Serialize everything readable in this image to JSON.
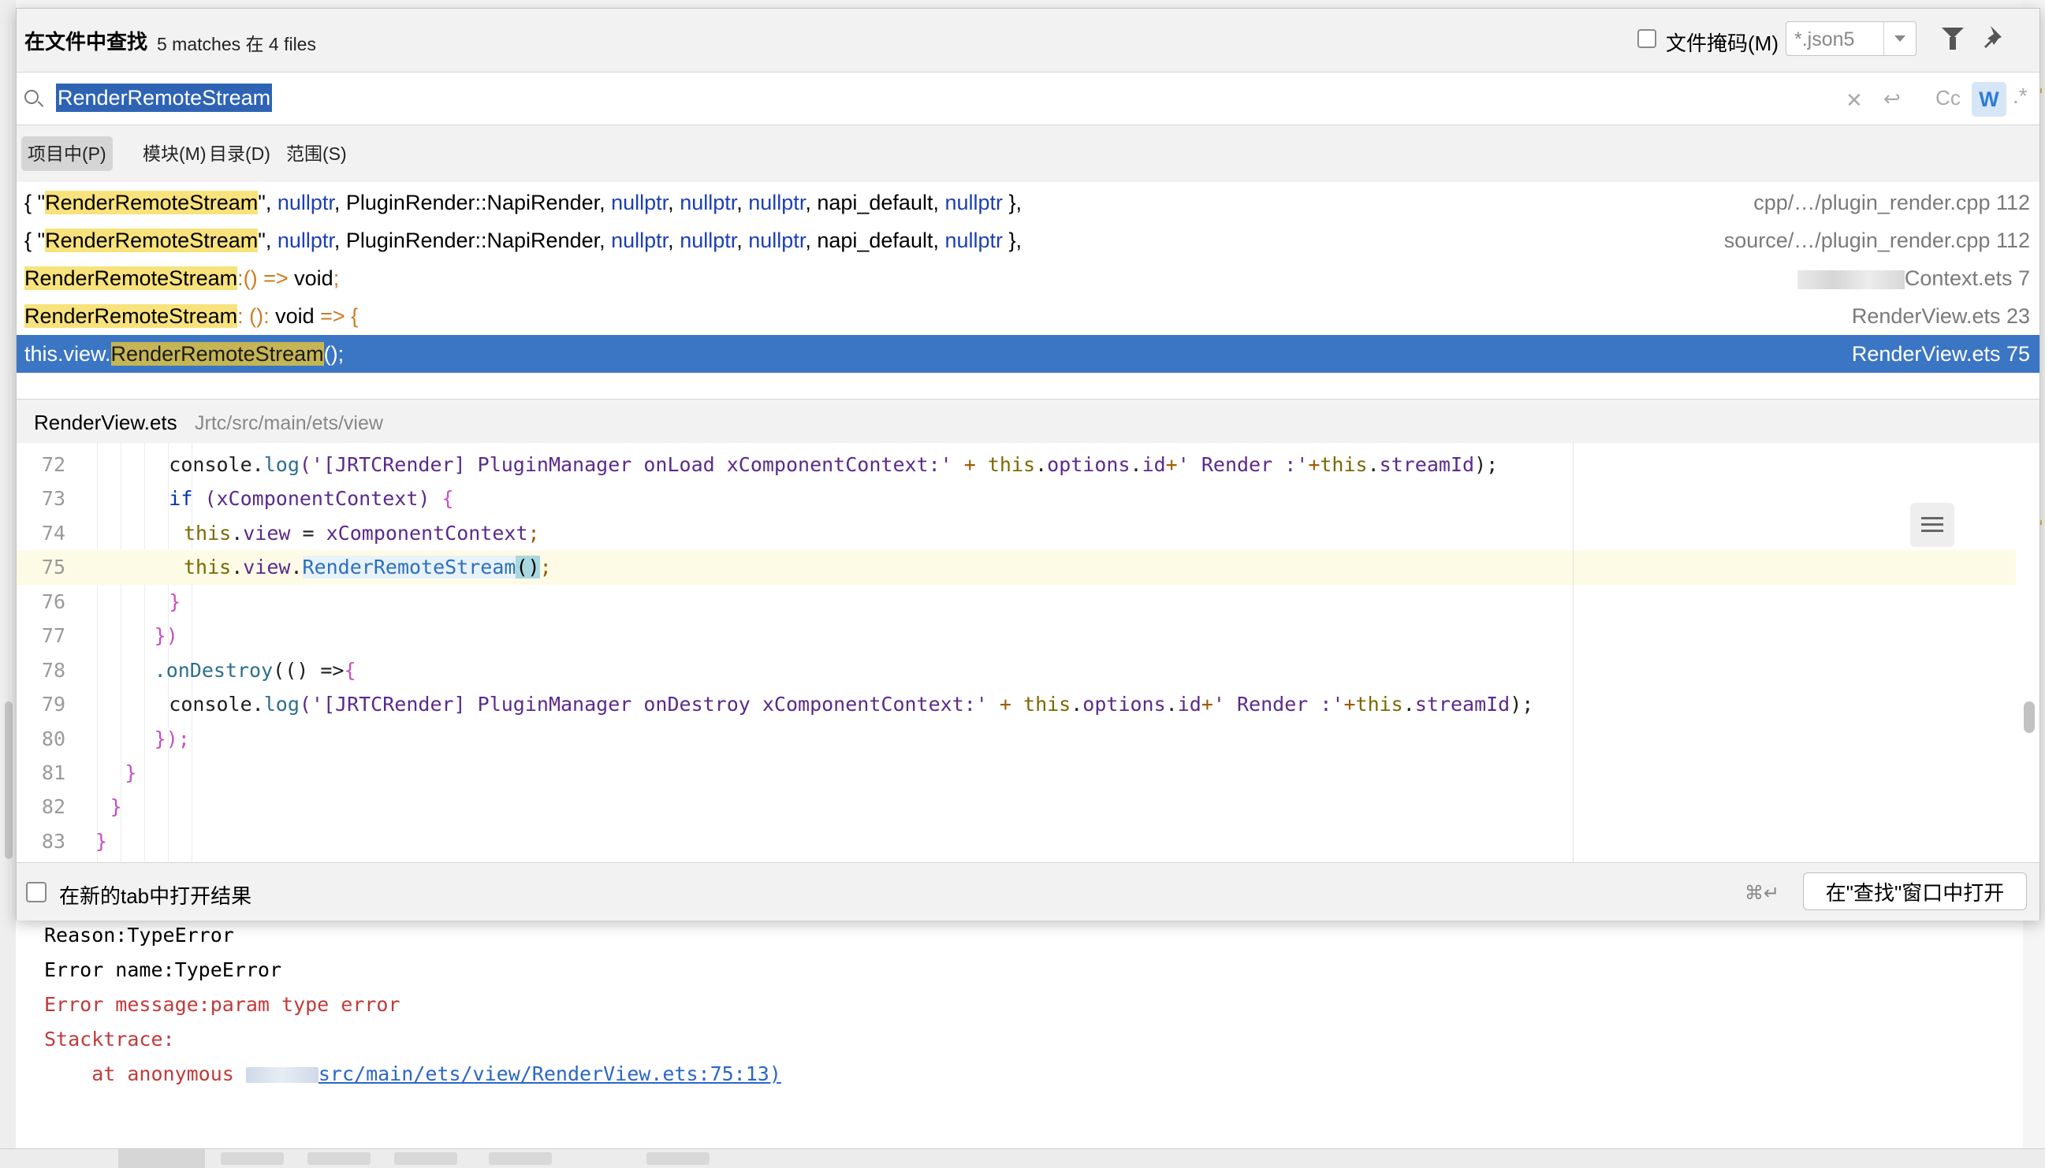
{
  "header": {
    "title": "在文件中查找",
    "match_count": "5 matches 在 4 files",
    "file_mask_label": "文件掩码(M)",
    "file_mask_value": "*.json5"
  },
  "search": {
    "query": "RenderRemoteStream",
    "match_case_label": "Cc",
    "words_label": "W",
    "regex_label": ".*"
  },
  "scopes": [
    {
      "label": "项目中(P)",
      "selected": true
    },
    {
      "label": "模块(M)",
      "selected": false
    },
    {
      "label": "目录(D)",
      "selected": false
    },
    {
      "label": "范围(S)",
      "selected": false
    }
  ],
  "results": [
    {
      "pre": "{ \"",
      "match": "RenderRemoteStream",
      "tokens": [
        {
          "t": "\", ",
          "c": ""
        },
        {
          "t": "nullptr",
          "c": "kw"
        },
        {
          "t": ", PluginRender::NapiRender, ",
          "c": ""
        },
        {
          "t": "nullptr",
          "c": "kw"
        },
        {
          "t": ", ",
          "c": ""
        },
        {
          "t": "nullptr",
          "c": "kw"
        },
        {
          "t": ", ",
          "c": ""
        },
        {
          "t": "nullptr",
          "c": "kw"
        },
        {
          "t": ", napi_default, ",
          "c": ""
        },
        {
          "t": "nullptr",
          "c": "kw"
        },
        {
          "t": " },",
          "c": ""
        }
      ],
      "location": "cpp/…/plugin_render.cpp 112"
    },
    {
      "pre": "{ \"",
      "match": "RenderRemoteStream",
      "tokens": [
        {
          "t": "\", ",
          "c": ""
        },
        {
          "t": "nullptr",
          "c": "kw"
        },
        {
          "t": ", PluginRender::NapiRender, ",
          "c": ""
        },
        {
          "t": "nullptr",
          "c": "kw"
        },
        {
          "t": ", ",
          "c": ""
        },
        {
          "t": "nullptr",
          "c": "kw"
        },
        {
          "t": ", ",
          "c": ""
        },
        {
          "t": "nullptr",
          "c": "kw"
        },
        {
          "t": ", napi_default, ",
          "c": ""
        },
        {
          "t": "nullptr",
          "c": "kw"
        },
        {
          "t": " },",
          "c": ""
        }
      ],
      "location": "source/…/plugin_render.cpp 112"
    },
    {
      "pre": "",
      "match": "RenderRemoteStream",
      "tokens": [
        {
          "t": ":() => ",
          "c": "op"
        },
        {
          "t": "void",
          "c": ""
        },
        {
          "t": ";",
          "c": "op"
        }
      ],
      "location": "Context.ets 7",
      "location_blurred": true
    },
    {
      "pre": "",
      "match": "RenderRemoteStream",
      "tokens": [
        {
          "t": ": (): ",
          "c": "op"
        },
        {
          "t": "void",
          "c": ""
        },
        {
          "t": " => {",
          "c": "op"
        }
      ],
      "location": "RenderView.ets 23"
    },
    {
      "pre": "this.view.",
      "match": "RenderRemoteStream",
      "tokens": [
        {
          "t": "();",
          "c": ""
        }
      ],
      "location": "RenderView.ets 75",
      "selected": true
    }
  ],
  "preview": {
    "file": "RenderView.ets",
    "path": "Jrtc/src/main/ets/view",
    "lines": [
      {
        "n": "72",
        "indent": 5,
        "tokens": [
          {
            "t": "console",
            "c": "c-plain"
          },
          {
            "t": ".",
            "c": "c-plain"
          },
          {
            "t": "log",
            "c": "c-func"
          },
          {
            "t": "('[JRTCRender] PluginManager onLoad xComponentContext:' ",
            "c": "c-prop"
          },
          {
            "t": "+ ",
            "c": "c-semi"
          },
          {
            "t": "this",
            "c": "c-this"
          },
          {
            "t": ".",
            "c": "c-plain"
          },
          {
            "t": "options",
            "c": "c-prop"
          },
          {
            "t": ".",
            "c": "c-plain"
          },
          {
            "t": "id",
            "c": "c-prop"
          },
          {
            "t": "+",
            "c": "c-semi"
          },
          {
            "t": "' Render :'",
            "c": "c-prop"
          },
          {
            "t": "+",
            "c": "c-semi"
          },
          {
            "t": "this",
            "c": "c-this"
          },
          {
            "t": ".",
            "c": "c-plain"
          },
          {
            "t": "streamId",
            "c": "c-prop"
          },
          {
            "t": ");",
            "c": "c-plain"
          }
        ]
      },
      {
        "n": "73",
        "indent": 5,
        "tokens": [
          {
            "t": "if",
            "c": "c-key"
          },
          {
            "t": " (xComponentContext) ",
            "c": "c-prop"
          },
          {
            "t": "{",
            "c": "c-br"
          }
        ]
      },
      {
        "n": "74",
        "indent": 6,
        "tokens": [
          {
            "t": "this",
            "c": "c-this"
          },
          {
            "t": ".",
            "c": "c-plain"
          },
          {
            "t": "view",
            "c": "c-prop"
          },
          {
            "t": " = ",
            "c": "c-plain"
          },
          {
            "t": "xComponentContext",
            "c": "c-prop"
          },
          {
            "t": ";",
            "c": "c-semi"
          }
        ]
      },
      {
        "n": "75",
        "indent": 6,
        "current": true,
        "tokens": [
          {
            "t": "this",
            "c": "c-this"
          },
          {
            "t": ".",
            "c": "c-plain"
          },
          {
            "t": "view",
            "c": "c-prop"
          },
          {
            "t": ".",
            "c": "c-plain"
          },
          {
            "t": "RenderRemoteStream",
            "c": "c-call"
          },
          {
            "t": "()",
            "c": "c-paren"
          },
          {
            "t": ";",
            "c": "c-semi"
          }
        ]
      },
      {
        "n": "76",
        "indent": 5,
        "tokens": [
          {
            "t": "}",
            "c": "c-br"
          }
        ]
      },
      {
        "n": "77",
        "indent": 4,
        "tokens": [
          {
            "t": "})",
            "c": "c-br"
          }
        ]
      },
      {
        "n": "78",
        "indent": 4,
        "tokens": [
          {
            "t": ".onDestroy",
            "c": "c-func"
          },
          {
            "t": "(() =>",
            "c": "c-plain"
          },
          {
            "t": "{",
            "c": "c-br"
          }
        ]
      },
      {
        "n": "79",
        "indent": 5,
        "tokens": [
          {
            "t": "console",
            "c": "c-plain"
          },
          {
            "t": ".",
            "c": "c-plain"
          },
          {
            "t": "log",
            "c": "c-func"
          },
          {
            "t": "('[JRTCRender] PluginManager onDestroy xComponentContext:' ",
            "c": "c-prop"
          },
          {
            "t": "+ ",
            "c": "c-semi"
          },
          {
            "t": "this",
            "c": "c-this"
          },
          {
            "t": ".",
            "c": "c-plain"
          },
          {
            "t": "options",
            "c": "c-prop"
          },
          {
            "t": ".",
            "c": "c-plain"
          },
          {
            "t": "id",
            "c": "c-prop"
          },
          {
            "t": "+",
            "c": "c-semi"
          },
          {
            "t": "' Render :'",
            "c": "c-prop"
          },
          {
            "t": "+",
            "c": "c-semi"
          },
          {
            "t": "this",
            "c": "c-this"
          },
          {
            "t": ".",
            "c": "c-plain"
          },
          {
            "t": "streamId",
            "c": "c-prop"
          },
          {
            "t": ");",
            "c": "c-plain"
          }
        ]
      },
      {
        "n": "80",
        "indent": 4,
        "tokens": [
          {
            "t": "});",
            "c": "c-br"
          }
        ]
      },
      {
        "n": "81",
        "indent": 2,
        "tokens": [
          {
            "t": "}",
            "c": "c-br"
          }
        ]
      },
      {
        "n": "82",
        "indent": 1,
        "tokens": [
          {
            "t": "}",
            "c": "c-br"
          }
        ]
      },
      {
        "n": "83",
        "indent": 0,
        "tokens": [
          {
            "t": "}",
            "c": "c-br"
          }
        ]
      }
    ]
  },
  "footer": {
    "new_tab_label": "在新的tab中打开结果",
    "shortcut": "⌘↵",
    "open_button": "在\"查找\"窗口中打开"
  },
  "console": {
    "lines": [
      {
        "text": "Reason:TypeError",
        "style": ""
      },
      {
        "text": "Error name:TypeError",
        "style": ""
      },
      {
        "text": "Error message:param type error",
        "style": "err"
      },
      {
        "text": "Stacktrace:",
        "style": "err"
      }
    ],
    "trace_prefix": "    at anonymous ",
    "trace_link": "src/main/ets/view/RenderView.ets:75:13)"
  },
  "colors": {
    "selection": "#3b76c4",
    "match_highlight": "#f8e27b",
    "keyword": "#1c3fb8",
    "error_text": "#c23a3a"
  }
}
